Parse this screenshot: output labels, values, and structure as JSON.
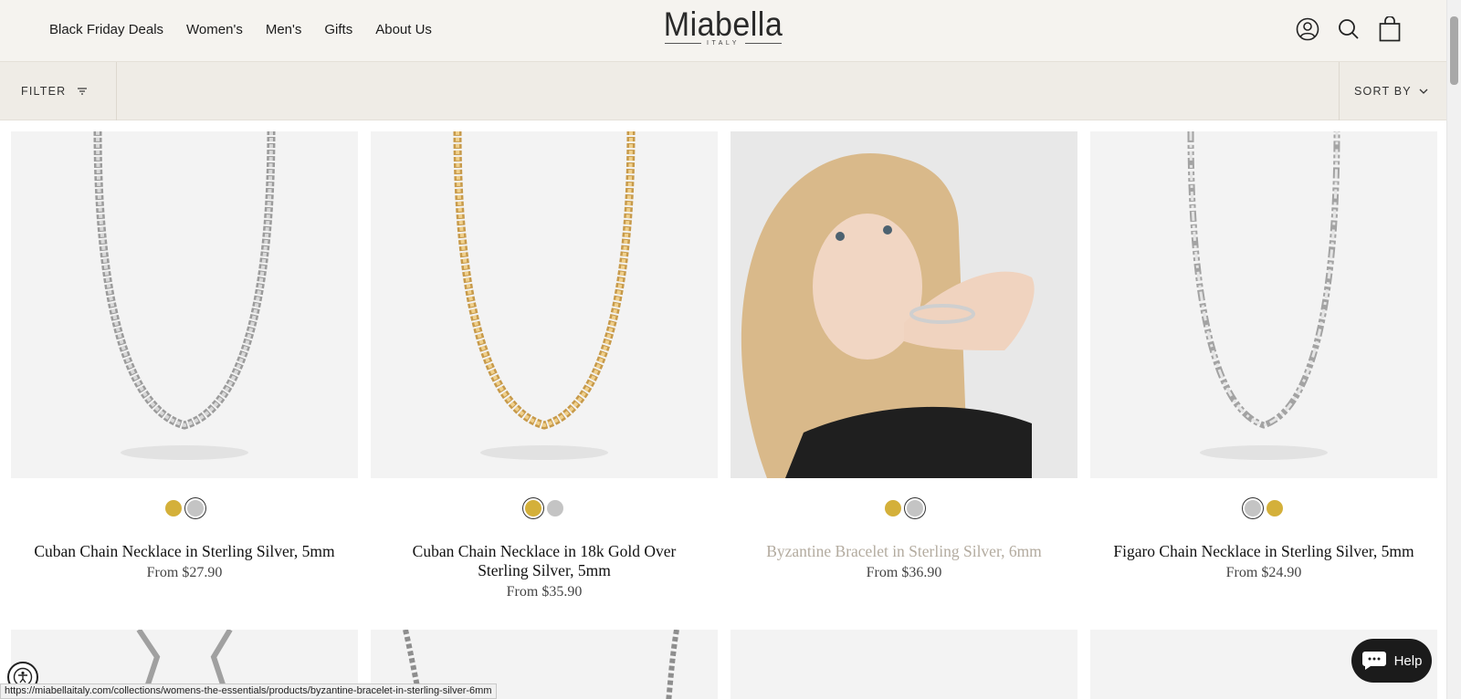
{
  "nav": {
    "items": [
      "Black Friday Deals",
      "Women's",
      "Men's",
      "Gifts",
      "About Us"
    ]
  },
  "logo": {
    "name": "Miabella",
    "sub": "ITALY"
  },
  "header_icons": [
    "account-icon",
    "search-icon",
    "cart-icon"
  ],
  "toolbar": {
    "filter_label": "FILTER",
    "sort_label": "SORT BY"
  },
  "colors": {
    "gold": "#d4b03a",
    "silver": "#c4c4c4",
    "header_bg": "#f5f3ef",
    "toolbar_bg": "#efece6"
  },
  "products": [
    {
      "title": "Cuban Chain Necklace in Sterling Silver, 5mm",
      "price": "From $27.90",
      "swatches": [
        "gold",
        "silver"
      ],
      "selected": 1
    },
    {
      "title": "Cuban Chain Necklace in 18k Gold Over Sterling Silver, 5mm",
      "price": "From $35.90",
      "swatches": [
        "gold",
        "silver"
      ],
      "selected": 0
    },
    {
      "title": "Byzantine Bracelet in Sterling Silver, 6mm",
      "price": "From $36.90",
      "swatches": [
        "gold",
        "silver"
      ],
      "selected": 1
    },
    {
      "title": "Figaro Chain Necklace in Sterling Silver, 5mm",
      "price": "From $24.90",
      "swatches": [
        "silver",
        "gold"
      ],
      "selected": 0
    }
  ],
  "status_url": "https://miabellaitaly.com/collections/womens-the-essentials/products/byzantine-bracelet-in-sterling-silver-6mm",
  "help_label": "Help"
}
